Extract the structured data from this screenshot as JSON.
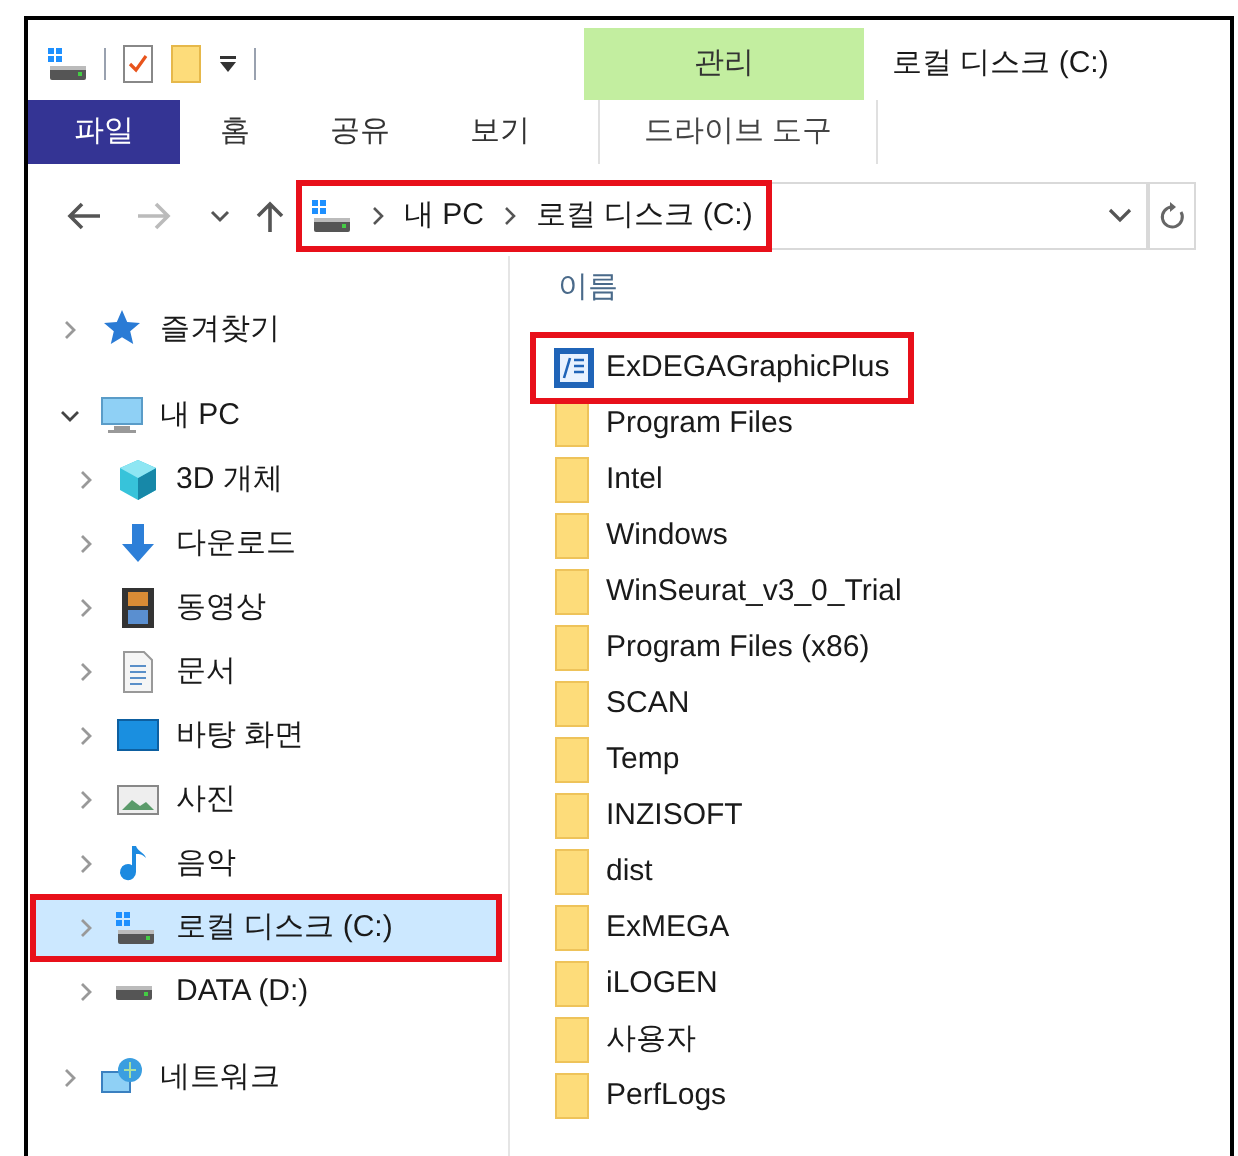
{
  "window": {
    "title": "로컬 디스크 (C:)"
  },
  "context_tab_group": {
    "label": "관리"
  },
  "ribbon_tabs": [
    {
      "label": "파일",
      "kind": "file"
    },
    {
      "label": "홈",
      "kind": "plain"
    },
    {
      "label": "공유",
      "kind": "plain"
    },
    {
      "label": "보기",
      "kind": "plain"
    },
    {
      "label": "드라이브 도구",
      "kind": "contextual"
    }
  ],
  "address_bar": {
    "breadcrumbs": [
      "내 PC",
      "로컬 디스크 (C:)"
    ],
    "highlighted": true
  },
  "navigation_pane": {
    "items": [
      {
        "label": "즐겨찾기",
        "kind": "favorites",
        "expanded": false,
        "selected": false,
        "highlighted": false
      },
      {
        "label": "내 PC",
        "kind": "pc",
        "expanded": true,
        "selected": false,
        "highlighted": false,
        "children": [
          {
            "label": "3D 개체",
            "kind": "objects3d",
            "expanded": false,
            "selected": false,
            "highlighted": false
          },
          {
            "label": "다운로드",
            "kind": "downloads",
            "expanded": false,
            "selected": false,
            "highlighted": false
          },
          {
            "label": "동영상",
            "kind": "videos",
            "expanded": false,
            "selected": false,
            "highlighted": false
          },
          {
            "label": "문서",
            "kind": "documents",
            "expanded": false,
            "selected": false,
            "highlighted": false
          },
          {
            "label": "바탕 화면",
            "kind": "desktop",
            "expanded": false,
            "selected": false,
            "highlighted": false
          },
          {
            "label": "사진",
            "kind": "pictures",
            "expanded": false,
            "selected": false,
            "highlighted": false
          },
          {
            "label": "음악",
            "kind": "music",
            "expanded": false,
            "selected": false,
            "highlighted": false
          },
          {
            "label": "로컬 디스크 (C:)",
            "kind": "system_drive",
            "expanded": false,
            "selected": true,
            "highlighted": true
          },
          {
            "label": "DATA (D:)",
            "kind": "drive",
            "expanded": false,
            "selected": false,
            "highlighted": false
          }
        ]
      },
      {
        "label": "네트워크",
        "kind": "network",
        "expanded": false,
        "selected": false,
        "highlighted": false
      }
    ]
  },
  "file_list": {
    "columns": [
      "이름"
    ],
    "rows": [
      {
        "name": "ExDEGAGraphicPlus",
        "kind": "app",
        "highlighted": true
      },
      {
        "name": "Program Files",
        "kind": "folder",
        "highlighted": false
      },
      {
        "name": "Intel",
        "kind": "folder",
        "highlighted": false
      },
      {
        "name": "Windows",
        "kind": "folder",
        "highlighted": false
      },
      {
        "name": "WinSeurat_v3_0_Trial",
        "kind": "folder",
        "highlighted": false
      },
      {
        "name": "Program Files (x86)",
        "kind": "folder",
        "highlighted": false
      },
      {
        "name": "SCAN",
        "kind": "folder",
        "highlighted": false
      },
      {
        "name": "Temp",
        "kind": "folder",
        "highlighted": false
      },
      {
        "name": "INZISOFT",
        "kind": "folder",
        "highlighted": false
      },
      {
        "name": "dist",
        "kind": "folder",
        "highlighted": false
      },
      {
        "name": "ExMEGA",
        "kind": "folder",
        "highlighted": false
      },
      {
        "name": "iLOGEN",
        "kind": "folder",
        "highlighted": false
      },
      {
        "name": "사용자",
        "kind": "folder",
        "highlighted": false
      },
      {
        "name": "PerfLogs",
        "kind": "folder",
        "highlighted": false
      }
    ]
  }
}
